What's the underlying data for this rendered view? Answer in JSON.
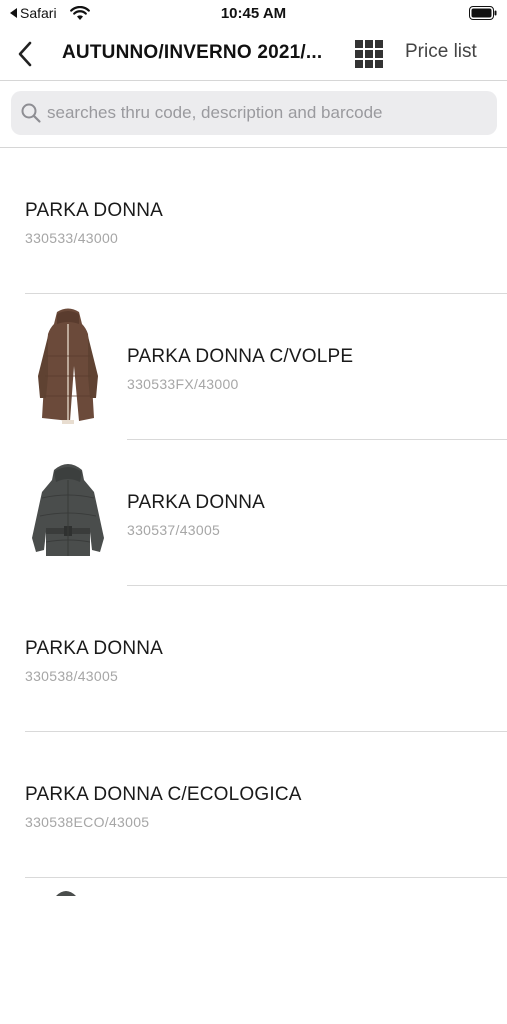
{
  "status_bar": {
    "back_app": "Safari",
    "time": "10:45 AM",
    "icons": [
      "back-arrow-icon",
      "wifi-icon",
      "battery-icon"
    ]
  },
  "nav": {
    "title": "AUTUNNO/INVERNO 2021/...",
    "price_list": "Price list",
    "icons": [
      "chevron-left-icon",
      "grid-icon"
    ]
  },
  "search": {
    "placeholder": "searches thru code, description and barcode",
    "value": ""
  },
  "products": [
    {
      "name": "PARKA DONNA",
      "code": "330533/43000",
      "thumbnail": "none"
    },
    {
      "name": "PARKA DONNA C/VOLPE",
      "code": "330533FX/43000",
      "thumbnail": "long-brown-parka"
    },
    {
      "name": "PARKA DONNA",
      "code": "330537/43005",
      "thumbnail": "short-grey-puffer"
    },
    {
      "name": "PARKA DONNA",
      "code": "330538/43005",
      "thumbnail": "none"
    },
    {
      "name": "PARKA DONNA C/ECOLOGICA",
      "code": "330538ECO/43005",
      "thumbnail": "none"
    }
  ],
  "colors": {
    "brown_parka": "#6b4a3a",
    "grey_puffer": "#4a4d4c",
    "divider": "#d9d9d9",
    "code_text": "#a6a6a6",
    "search_bg": "#ececee"
  }
}
